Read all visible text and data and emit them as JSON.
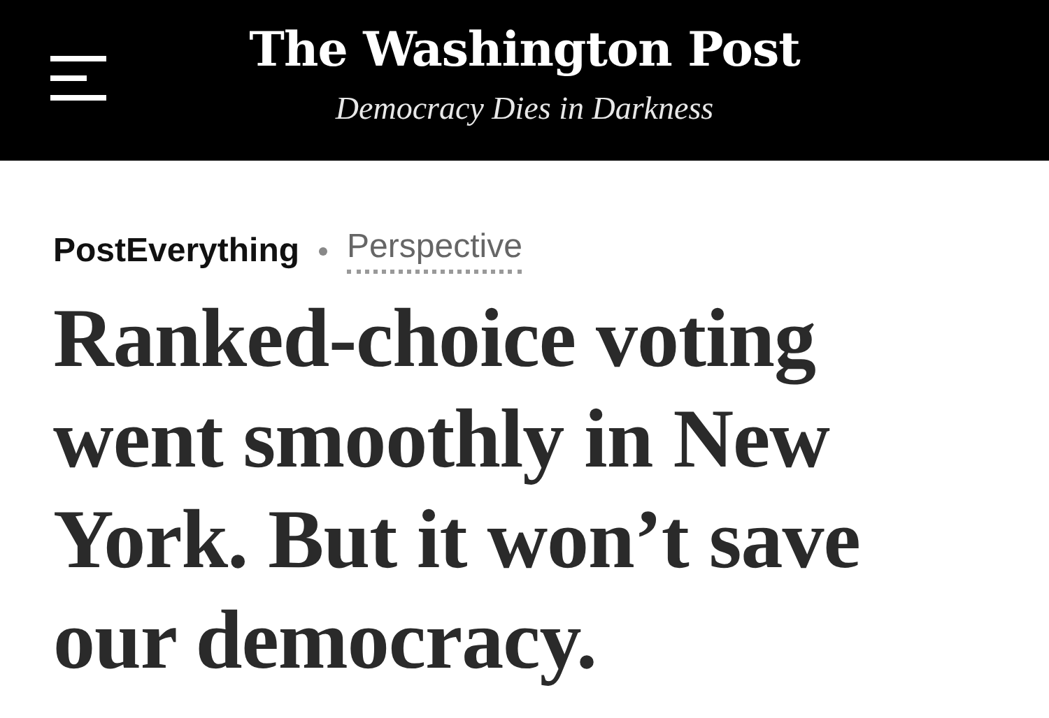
{
  "header": {
    "logo": "The Washington Post",
    "tagline": "Democracy Dies in Darkness"
  },
  "article": {
    "section": "PostEverything",
    "label": "Perspective",
    "headline": "Ranked-choice voting went smoothly in New York. But it won’t save our democracy."
  }
}
